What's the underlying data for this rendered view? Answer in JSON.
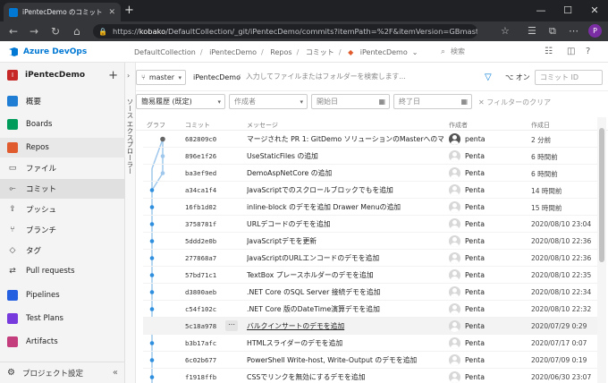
{
  "browser": {
    "tab_title": "iPentecDemo のコミット - Repos",
    "new_tab": "+",
    "url_host": "kobako",
    "url_path": "/DefaultCollection/_git/iPentecDemo/commits?itemPath=%2F&itemVersion=GBmaster",
    "url_scheme": "https://",
    "profile_initial": "P"
  },
  "header": {
    "brand": "Azure DevOps",
    "breadcrumbs": [
      "DefaultCollection",
      "iPentecDemo",
      "Repos",
      "コミット",
      "iPentecDemo"
    ],
    "search_placeholder": "検索"
  },
  "sidebar": {
    "project_initial": "I",
    "project_name": "iPentecDemo",
    "items": [
      {
        "label": "概要",
        "icon": "overview-icon",
        "color": "#1f7ed4"
      },
      {
        "label": "Boards",
        "icon": "boards-icon",
        "color": "#009c5c"
      },
      {
        "label": "Repos",
        "icon": "repos-icon",
        "color": "#e05b2d"
      },
      {
        "label": "ファイル",
        "icon": "files-icon"
      },
      {
        "label": "コミット",
        "icon": "commit-icon"
      },
      {
        "label": "プッシュ",
        "icon": "push-icon"
      },
      {
        "label": "ブランチ",
        "icon": "branch-icon"
      },
      {
        "label": "タグ",
        "icon": "tag-icon"
      },
      {
        "label": "Pull requests",
        "icon": "pull-request-icon"
      },
      {
        "label": "Pipelines",
        "icon": "pipelines-icon",
        "color": "#2560e0"
      },
      {
        "label": "Test Plans",
        "icon": "test-plans-icon",
        "color": "#773adc"
      },
      {
        "label": "Artifacts",
        "icon": "artifacts-icon",
        "color": "#c43d7c"
      }
    ],
    "settings_label": "プロジェクト設定"
  },
  "explorer_label": "ソース エクスプローラー",
  "toolbar": {
    "branch": "master",
    "repo": "iPentecDemo",
    "path_placeholder": "入力してファイルまたはフォルダーを検索します...",
    "on_label": "オン",
    "commit_id_placeholder": "コミット ID"
  },
  "filters": {
    "history": "簡易履歴 (既定)",
    "author": "作成者",
    "start_date": "開始日",
    "end_date": "終了日",
    "clear": "フィルターのクリア"
  },
  "columns": {
    "graph": "グラフ",
    "commit": "コミット",
    "message": "メッセージ",
    "author": "作成者",
    "date": "作成日"
  },
  "commits": [
    {
      "hash": "682809c0",
      "message": "マージされた PR 1: GitDemo ソリューションのMasterへのマージ",
      "author": "penta",
      "date": "2 分前"
    },
    {
      "hash": "896e1f26",
      "message": "UseStaticFiles の追加",
      "author": "Penta",
      "date": "6 時間前"
    },
    {
      "hash": "ba3ef9ed",
      "message": "DemoAspNetCore の追加",
      "author": "Penta",
      "date": "6 時間前"
    },
    {
      "hash": "a34ca1f4",
      "message": "JavaScriptでのスクロールブロックでもを追加",
      "author": "Penta",
      "date": "14 時間前"
    },
    {
      "hash": "16fb1d02",
      "message": "inline-block のデモを追加 Drawer Menuの追加",
      "author": "Penta",
      "date": "15 時間前"
    },
    {
      "hash": "3758781f",
      "message": "URLデコードのデモを追加",
      "author": "Penta",
      "date": "2020/08/10 23:04"
    },
    {
      "hash": "5ddd2e0b",
      "message": "JavaScriptデモを更新",
      "author": "Penta",
      "date": "2020/08/10 22:36"
    },
    {
      "hash": "277868a7",
      "message": "JavaScriptのURLエンコードのデモを追加",
      "author": "Penta",
      "date": "2020/08/10 22:36"
    },
    {
      "hash": "57bd71c1",
      "message": "TextBox プレースホルダーのデモを追加",
      "author": "Penta",
      "date": "2020/08/10 22:35"
    },
    {
      "hash": "d3800aeb",
      "message": ".NET Core のSQL Server 接続デモを追加",
      "author": "Penta",
      "date": "2020/08/10 22:34"
    },
    {
      "hash": "c54f102c",
      "message": ".NET Core 版のDateTime演算デモを追加",
      "author": "Penta",
      "date": "2020/08/10 22:32"
    },
    {
      "hash": "5c18a978",
      "message": "バルクインサートのデモを追加",
      "author": "Penta",
      "date": "2020/07/29 0:29"
    },
    {
      "hash": "b3b17afc",
      "message": "HTMLスライダーのデモを追加",
      "author": "Penta",
      "date": "2020/07/17 0:07"
    },
    {
      "hash": "6c02b677",
      "message": "PowerShell Write-host, Write-Output のデモを追加",
      "author": "Penta",
      "date": "2020/07/09 0:19"
    },
    {
      "hash": "f1918ffb",
      "message": "CSSでリンクを無効にするデモを追加",
      "author": "Penta",
      "date": "2020/06/30 23:07"
    }
  ],
  "colors": {
    "accent": "#0078d4",
    "graph_line": "#9fc8ec",
    "graph_dot": "#2f8fdf",
    "repos_selected": "#e05b2d"
  }
}
